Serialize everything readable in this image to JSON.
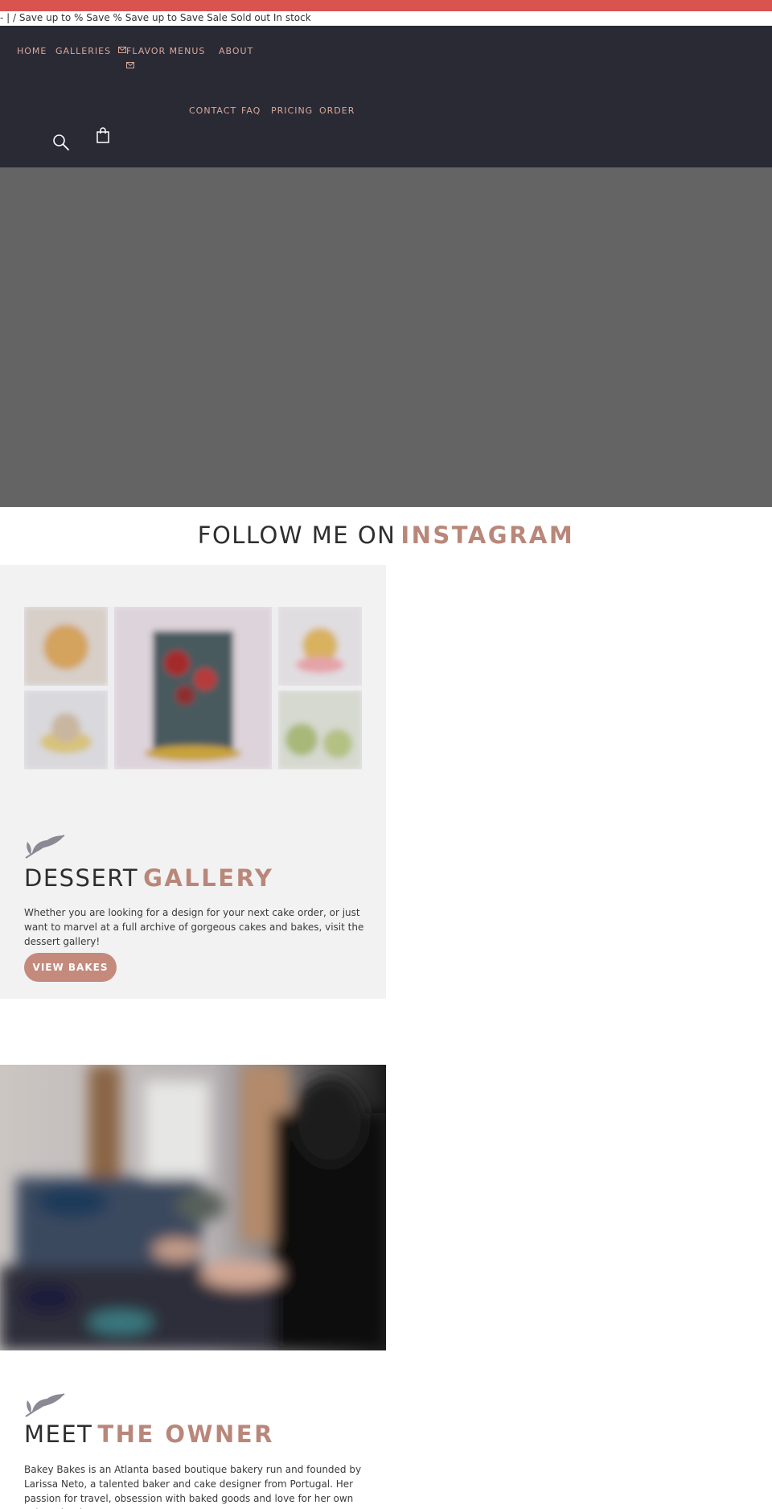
{
  "announcement": {
    "text": "- | / Save up to % Save % Save up to Save Sale Sold out In stock"
  },
  "nav": {
    "home": "HOME",
    "galleries": "GALLERIES",
    "flavor_menus": "FLAVOR MENUS",
    "about": "ABOUT",
    "contact": "CONTACT",
    "faq": "FAQ",
    "pricing": "PRICING",
    "order": "ORDER"
  },
  "icons": {
    "search": "search-icon",
    "cart": "shopping-bag-icon",
    "mail": "envelope-icon",
    "sprig": "leaf-sprig-icon"
  },
  "instagram": {
    "prefix": "FOLLOW ME ON",
    "accent": "INSTAGRAM"
  },
  "gallery": {
    "title_prefix": "DESSERT",
    "title_accent": "GALLERY",
    "body": "Whether you are looking for a design for your next cake order, or just want to marvel at a full archive of gorgeous cakes and bakes, visit the dessert gallery!",
    "button": "VIEW BAKES"
  },
  "owner": {
    "title_prefix": "MEET",
    "title_accent": "THE OWNER",
    "body": "Bakey Bakes is an Atlanta based boutique bakery run and founded by Larissa Neto, a talented baker and cake designer from Portugal. Her passion for travel, obsession with baked goods and love for her own culture is what"
  },
  "colors": {
    "accent": "#b9877a",
    "header_bg": "#2a2a35",
    "topbar": "#d9534f",
    "button": "#c48a7c"
  }
}
